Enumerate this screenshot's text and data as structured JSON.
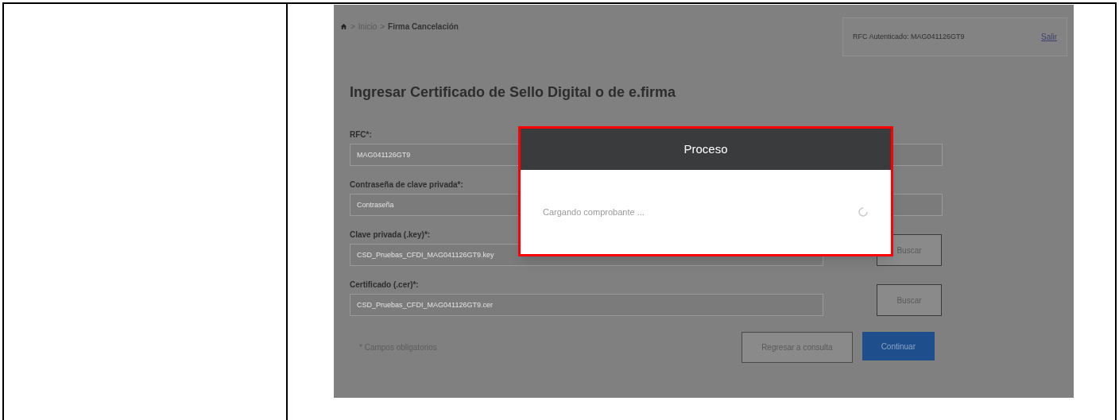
{
  "breadcrumb": {
    "items": [
      "Inicio",
      "Firma Cancelación"
    ],
    "separator": ">"
  },
  "session": {
    "label": "RFC Autenticado: MAG041126GT9",
    "logout": "Salir"
  },
  "form": {
    "title": "Ingresar Certificado de Sello Digital o de e.firma",
    "fields": [
      {
        "kind": "text",
        "label": "RFC*:",
        "value": "MAG041126GT9"
      },
      {
        "kind": "password",
        "label": "Contraseña de clave privada*:",
        "placeholder": "Contraseña"
      },
      {
        "kind": "file",
        "label": "Clave privada (.key)*:",
        "value": "CSD_Pruebas_CFDI_MAG041126GT9.key",
        "button": "Buscar"
      },
      {
        "kind": "file",
        "label": "Certificado (.cer)*:",
        "value": "CSD_Pruebas_CFDI_MAG041126GT9.cer",
        "button": "Buscar"
      }
    ],
    "note": "* Campos obligatorios",
    "buttons": [
      {
        "label": "Regresar a consulta",
        "primary": false
      },
      {
        "label": "Continuar",
        "primary": true
      }
    ]
  },
  "modal": {
    "title": "Proceso",
    "message": "Cargando comprobante ..."
  }
}
